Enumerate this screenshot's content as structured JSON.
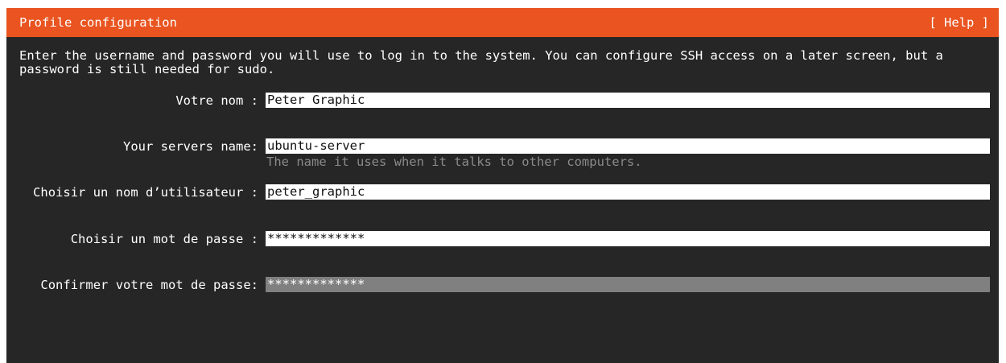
{
  "header": {
    "title": "Profile configuration",
    "help_label": "[ Help ]"
  },
  "intro": "Enter the username and password you will use to log in to the system. You can configure SSH access on a later screen, but a\npassword is still needed for sudo.",
  "form": {
    "name": {
      "label": "Votre nom :",
      "value": "Peter Graphic"
    },
    "server": {
      "label": "Your servers name:",
      "value": "ubuntu-server",
      "hint": "The name it uses when it talks to other computers."
    },
    "username": {
      "label": "Choisir un nom d’utilisateur :",
      "value": "peter_graphic"
    },
    "password": {
      "label": "Choisir un mot de passe :",
      "value": "*************"
    },
    "confirm": {
      "label": "Confirmer votre mot de passe:",
      "value": "*************"
    }
  },
  "colors": {
    "header_bg": "#e95420",
    "screen_bg": "#262626",
    "field_bg": "#ffffff",
    "focused_field_bg": "#808080",
    "hint_text": "#8a8a8a"
  }
}
